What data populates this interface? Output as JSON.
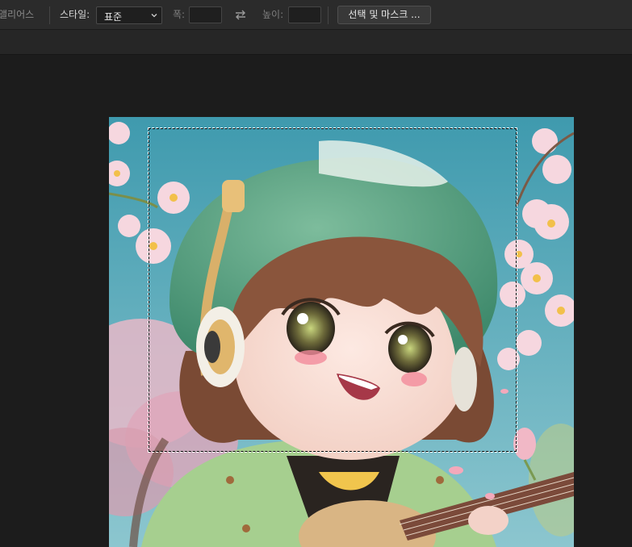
{
  "options_bar": {
    "antialias_label": "앨리어스",
    "style_label": "스타일:",
    "style_value": "표준",
    "width_label": "폭:",
    "width_value": "",
    "height_label": "높이:",
    "height_value": "",
    "select_mask_label": "선택 및 마스크 ..."
  },
  "icons": {
    "style_dropdown": "chevron-down-icon",
    "swap": "swap-arrows-icon"
  },
  "colors": {
    "toolbar_bg": "#2b2b2b",
    "workspace_bg": "#1c1c1c",
    "sky": "#4fa6b8",
    "hat": "#5da386",
    "blossom": "#f3c9d4"
  }
}
